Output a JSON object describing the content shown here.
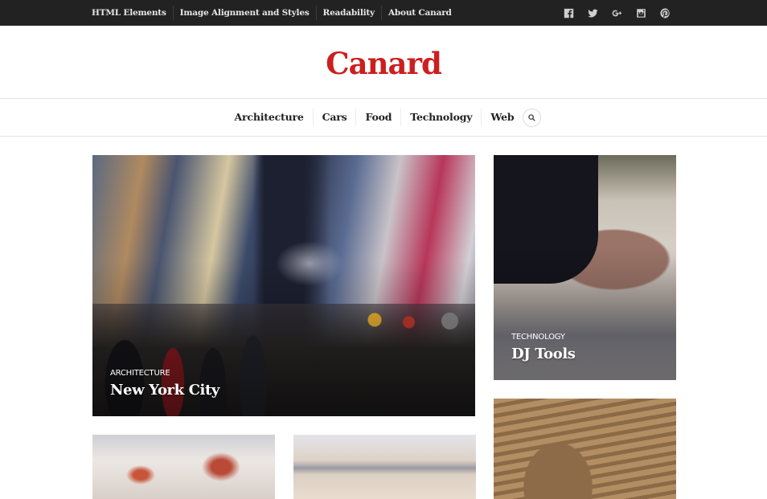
{
  "topbar": {
    "nav": [
      {
        "label": "HTML Elements"
      },
      {
        "label": "Image Alignment and Styles"
      },
      {
        "label": "Readability"
      },
      {
        "label": "About Canard"
      }
    ],
    "social": [
      {
        "icon": "facebook-icon"
      },
      {
        "icon": "twitter-icon"
      },
      {
        "icon": "google-plus-icon"
      },
      {
        "icon": "instagram-icon"
      },
      {
        "icon": "pinterest-icon"
      }
    ]
  },
  "site": {
    "title": "Canard",
    "brand_color": "#cc1f1f"
  },
  "main_nav": {
    "items": [
      {
        "label": "Architecture"
      },
      {
        "label": "Cars"
      },
      {
        "label": "Food"
      },
      {
        "label": "Technology"
      },
      {
        "label": "Web"
      }
    ],
    "search_icon": "search-icon"
  },
  "posts": [
    {
      "category": "ARCHITECTURE",
      "title": "New York City"
    },
    {
      "category": "TECHNOLOGY",
      "title": "DJ Tools"
    },
    {
      "category": "",
      "title": ""
    },
    {
      "category": "",
      "title": ""
    },
    {
      "category": "",
      "title": ""
    }
  ]
}
